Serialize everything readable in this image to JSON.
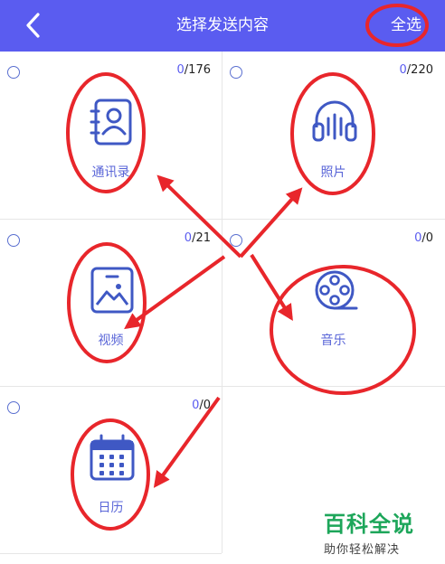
{
  "header": {
    "title": "选择发送内容",
    "select_all": "全选"
  },
  "items": [
    {
      "label": "通讯录",
      "selected": "0",
      "total": "/176",
      "icon": "contacts-icon"
    },
    {
      "label": "照片",
      "selected": "0",
      "total": "/220",
      "icon": "headphones-icon"
    },
    {
      "label": "视频",
      "selected": "0",
      "total": "/21",
      "icon": "image-icon"
    },
    {
      "label": "音乐",
      "selected": "0",
      "total": "/0",
      "icon": "film-reel-icon"
    },
    {
      "label": "日历",
      "selected": "0",
      "total": "/0",
      "icon": "calendar-icon"
    }
  ],
  "colors": {
    "header": "#5a5cf0",
    "accent": "#5a66d8",
    "annotation": "#e8262b"
  },
  "watermark": {
    "brand": "百科全说",
    "tagline": "助你轻松解决"
  }
}
